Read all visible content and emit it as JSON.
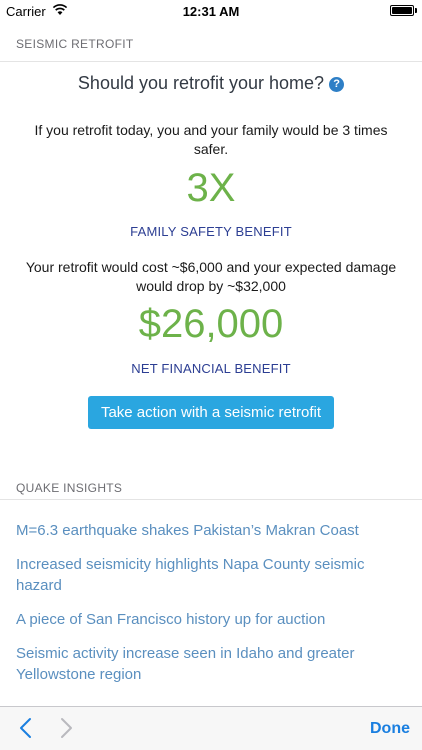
{
  "status_bar": {
    "carrier": "Carrier",
    "time": "12:31 AM"
  },
  "retrofit": {
    "section_title": "SEISMIC RETROFIT",
    "question": "Should you retrofit your home?",
    "help_icon": "?",
    "safety_text": "If you retrofit today, you and your family would be 3 times safer.",
    "safety_value": "3X",
    "safety_caption": "FAMILY SAFETY BENEFIT",
    "cost_text": "Your retrofit would cost ~$6,000 and your expected damage would drop by ~$32,000",
    "financial_value": "$26,000",
    "financial_caption": "NET FINANCIAL BENEFIT",
    "action_label": "Take action with a seismic retrofit"
  },
  "insights": {
    "section_title": "QUAKE INSIGHTS",
    "items": [
      {
        "title": "M=6.3 earthquake shakes Pakistan’s Makran Coast"
      },
      {
        "title": "Increased seismicity highlights Napa County seismic hazard"
      },
      {
        "title": "A piece of San Francisco history up for auction"
      },
      {
        "title": "Seismic activity increase seen in Idaho and greater Yellowstone region"
      }
    ]
  },
  "toolbar": {
    "done_label": "Done"
  },
  "colors": {
    "accent_green": "#6db24a",
    "caption_blue": "#2c3e93",
    "button_blue": "#2aa6e0",
    "link_blue": "#5a8fbf",
    "toolbar_blue": "#1a7fe0"
  },
  "icons": {
    "back": "chevron-left-icon",
    "forward": "chevron-right-icon",
    "help": "question-circle-icon",
    "wifi": "wifi-icon",
    "battery": "battery-icon"
  }
}
